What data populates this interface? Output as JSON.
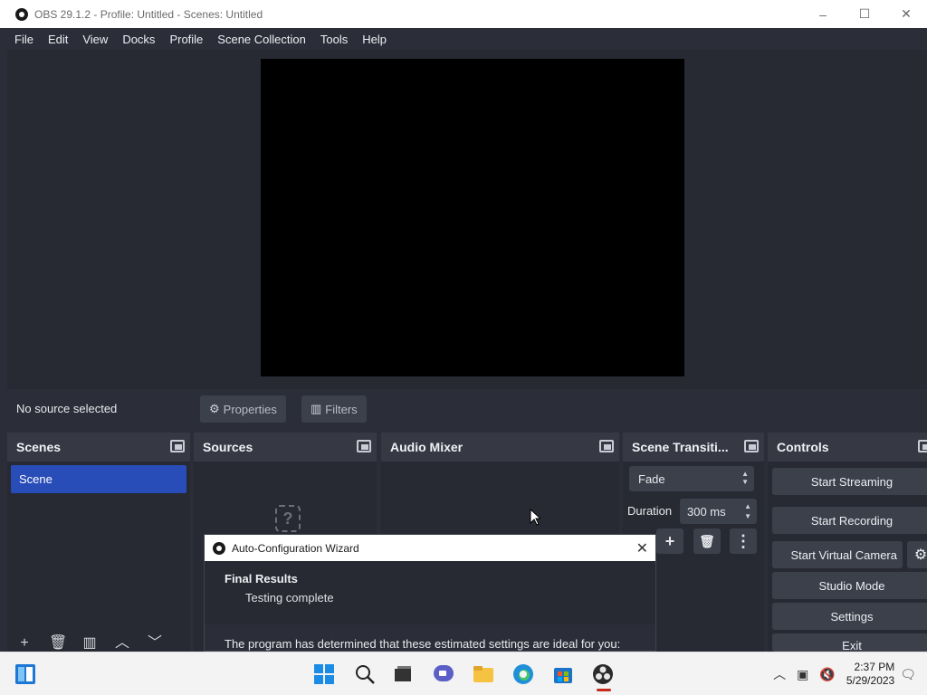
{
  "window": {
    "title": "OBS 29.1.2 - Profile: Untitled - Scenes: Untitled"
  },
  "window_controls": [
    "–",
    "☐",
    "✕"
  ],
  "menu": [
    "File",
    "Edit",
    "View",
    "Docks",
    "Profile",
    "Scene Collection",
    "Tools",
    "Help"
  ],
  "source_bar": {
    "no_source": "No source selected",
    "properties_label": "Properties",
    "filters_label": "Filters"
  },
  "docks": {
    "scenes": {
      "title": "Scenes",
      "items": [
        "Scene"
      ]
    },
    "sources": {
      "title": "Sources"
    },
    "audio_mixer": {
      "title": "Audio Mixer"
    },
    "scene_transitions": {
      "title": "Scene Transiti...",
      "transition": "Fade",
      "duration_label": "Duration",
      "duration_value": "300 ms"
    },
    "controls": {
      "title": "Controls",
      "buttons": [
        "Start Streaming",
        "Start Recording",
        "Start Virtual Camera",
        "Studio Mode",
        "Settings",
        "Exit"
      ]
    }
  },
  "wizard": {
    "title": "Auto-Configuration Wizard",
    "heading": "Final Results",
    "subheading": "Testing complete",
    "body": "The program has determined that these estimated settings are ideal for you:"
  },
  "taskbar": {
    "time": "2:37 PM",
    "date": "5/29/2023"
  },
  "colors": {
    "accent": "#284cb8",
    "panel_bg": "#272a33",
    "header_bg": "#363944",
    "button_bg": "#3c404b"
  }
}
